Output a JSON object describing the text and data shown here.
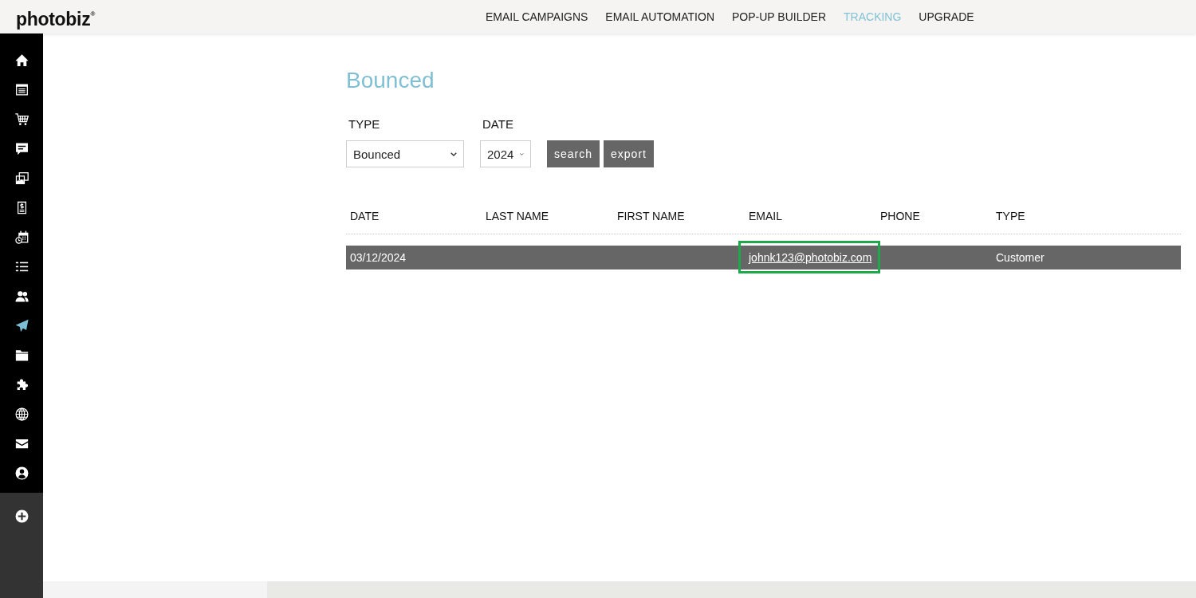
{
  "header": {
    "logo": "photobiz$^{®}$",
    "nav": [
      {
        "label": "EMAIL CAMPAIGNS",
        "selected": false
      },
      {
        "label": "EMAIL AUTOMATION",
        "selected": false
      },
      {
        "label": "POP-UP BUILDER",
        "selected": false
      },
      {
        "label": "TRACKING",
        "selected": true
      },
      {
        "label": "UPGRADE",
        "selected": false
      }
    ]
  },
  "sidebar": {
    "items": [
      {
        "selected": false
      },
      {
        "selected": false
      },
      {
        "selected": false
      },
      {
        "selected": false
      },
      {
        "selected": false
      },
      {
        "selected": false
      },
      {
        "selected": false
      },
      {
        "selected": false
      },
      {
        "selected": false
      },
      {
        "selected": true
      },
      {
        "selected": false
      },
      {
        "selected": false
      },
      {
        "selected": false
      },
      {
        "selected": false
      },
      {
        "selected": false
      }
    ]
  },
  "page": {
    "title": "Bounced",
    "filters": [
      {
        "label": "TYPE",
        "value": "Bounced"
      },
      {
        "label": "DATE",
        "value": "2024"
      }
    ],
    "buttons": [
      "search",
      "export"
    ]
  },
  "table": {
    "columns": [
      "DATE",
      "LAST NAME",
      "FIRST NAME",
      "EMAIL",
      "PHONE",
      "TYPE"
    ],
    "rows": [
      {
        "cells": [
          {
            "text": "03/12/2024",
            "kind": "text",
            "highlighted": false
          },
          {
            "highlighted": false
          },
          {
            "highlighted": false
          },
          {
            "text": "johnk123@photobiz.com",
            "kind": "link",
            "highlighted": true
          },
          {
            "highlighted": false
          },
          {
            "text": "Customer",
            "kind": "text",
            "highlighted": false
          }
        ]
      }
    ]
  }
}
